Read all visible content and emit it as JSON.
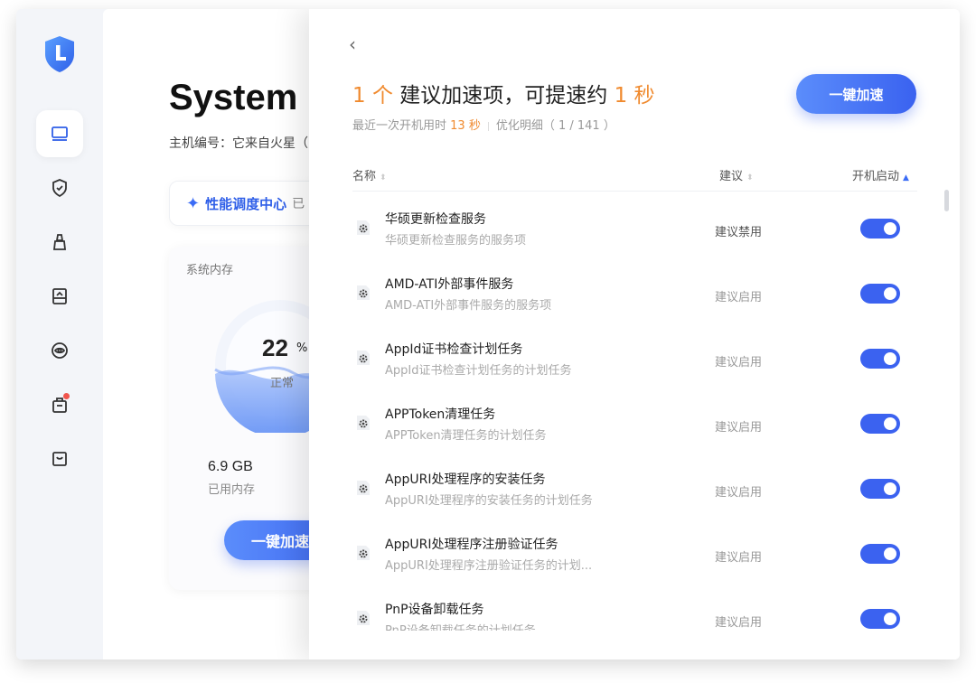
{
  "sidebar": {
    "items": [
      {
        "name": "monitor-icon"
      },
      {
        "name": "shield-check-icon"
      },
      {
        "name": "broom-icon"
      },
      {
        "name": "drive-icon"
      },
      {
        "name": "eye-privacy-icon"
      },
      {
        "name": "toolbox-icon",
        "badge_color": "#f0554d"
      },
      {
        "name": "inbox-icon"
      }
    ],
    "active_index": 0
  },
  "main": {
    "title": "System",
    "subtitle": "主机编号：它来自火星（",
    "perf_label": "性能调度中心",
    "perf_extra": "已",
    "memory": {
      "label": "系统内存",
      "percent": "22",
      "percent_unit": "%",
      "percent_value": 22,
      "status": "正常",
      "used_value": "6.9 GB",
      "used_label": "已用内存"
    },
    "boost_label": "一键加速"
  },
  "panel": {
    "headline": {
      "count": "1 个",
      "text1": " 建议加速项，可提速约 ",
      "seconds": "1 秒"
    },
    "subline": {
      "prefix": "最近一次开机用时 ",
      "boot_time": "13 秒",
      "optimize": "优化明细（ 1 / 141 ）"
    },
    "boost_label": "一键加速",
    "columns": {
      "name": "名称",
      "recommend": "建议",
      "startup": "开机启动"
    },
    "rows": [
      {
        "name": "华硕更新检查服务",
        "desc": "华硕更新检查服务的服务项",
        "rec": "建议禁用",
        "enabled": true
      },
      {
        "name": "AMD-ATI外部事件服务",
        "desc": "AMD-ATI外部事件服务的服务项",
        "rec": "建议启用",
        "enabled": true
      },
      {
        "name": "AppId证书检查计划任务",
        "desc": "AppId证书检查计划任务的计划任务",
        "rec": "建议启用",
        "enabled": true
      },
      {
        "name": "APPToken清理任务",
        "desc": "APPToken清理任务的计划任务",
        "rec": "建议启用",
        "enabled": true
      },
      {
        "name": "AppURI处理程序的安装任务",
        "desc": "AppURI处理程序的安装任务的计划任务",
        "rec": "建议启用",
        "enabled": true
      },
      {
        "name": "AppURI处理程序注册验证任务",
        "desc": "AppURI处理程序注册验证任务的计划...",
        "rec": "建议启用",
        "enabled": true
      },
      {
        "name": "PnP设备卸载任务",
        "desc": "PnP设备卸载任务的计划任务",
        "rec": "建议启用",
        "enabled": true
      }
    ]
  }
}
